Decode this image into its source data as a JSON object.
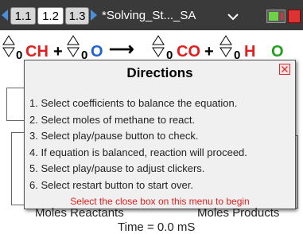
{
  "tabs": [
    "1.1",
    "1.2",
    "1.3"
  ],
  "active_tab": "1.2",
  "document_title": "*Solving_St..._SA",
  "equation": {
    "coef": "0",
    "reactant1": "CH",
    "plus": "+",
    "reactant2": "O",
    "reactant2_coef": "0",
    "arrow": "⟶",
    "product1": "CO",
    "product2_prefix": "H",
    "product2_suffix": "O",
    "colors": {
      "methane": "#e02020",
      "oxygen": "#2060d0",
      "co2": "#e02020",
      "water_h": "#e02020",
      "water_o": "#20a020"
    }
  },
  "dialog": {
    "title": "Directions",
    "items": [
      "1. Select coefficients to balance the equation.",
      "2. Select moles of methane to react.",
      "3. Select play/pause button to check.",
      "4. If equation is balanced, reaction will proceed.",
      "5. Select play/pause to adjust clickers.",
      "6. Select restart button to start over."
    ],
    "note": "Select the close box on this menu to begin"
  },
  "background": {
    "moles_reactants": "Moles Reactants",
    "moles_products": "Moles Products",
    "time": "Time = 0.0 mS"
  }
}
